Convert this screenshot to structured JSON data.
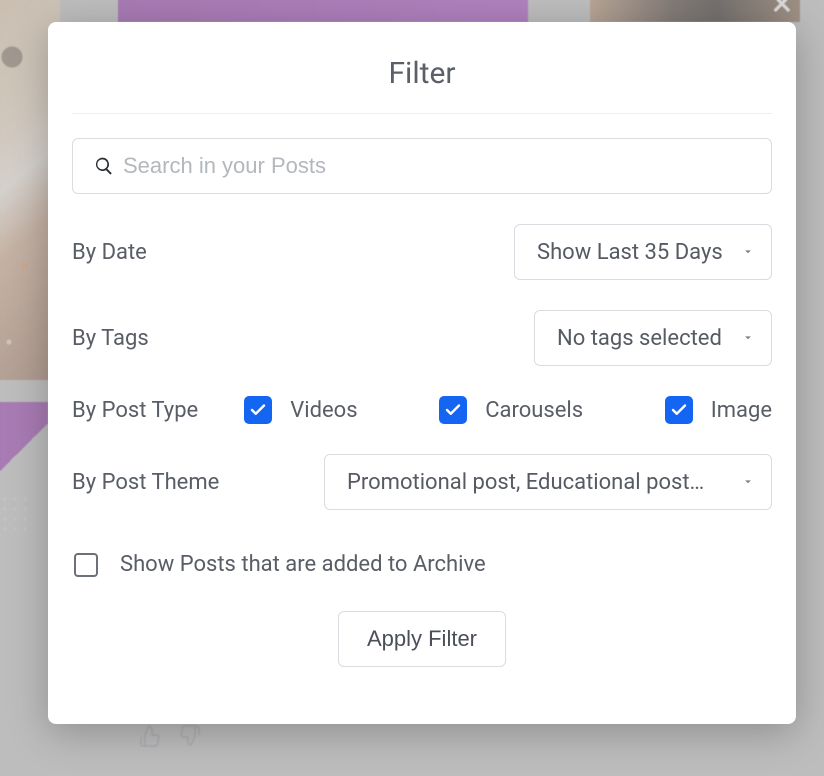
{
  "modal": {
    "title": "Filter",
    "search_placeholder": "Search in your Posts",
    "by_date_label": "By Date",
    "date_value": "Show Last 35 Days",
    "by_tags_label": "By Tags",
    "tags_value": "No tags selected",
    "by_posttype_label": "By Post Type",
    "posttype": {
      "videos": "Videos",
      "carousels": "Carousels",
      "image": "Image"
    },
    "by_posttheme_label": "By Post Theme",
    "posttheme_value": "Promotional post, Educational post,…",
    "archive_label": "Show Posts that are added to Archive",
    "apply_label": "Apply Filter"
  }
}
